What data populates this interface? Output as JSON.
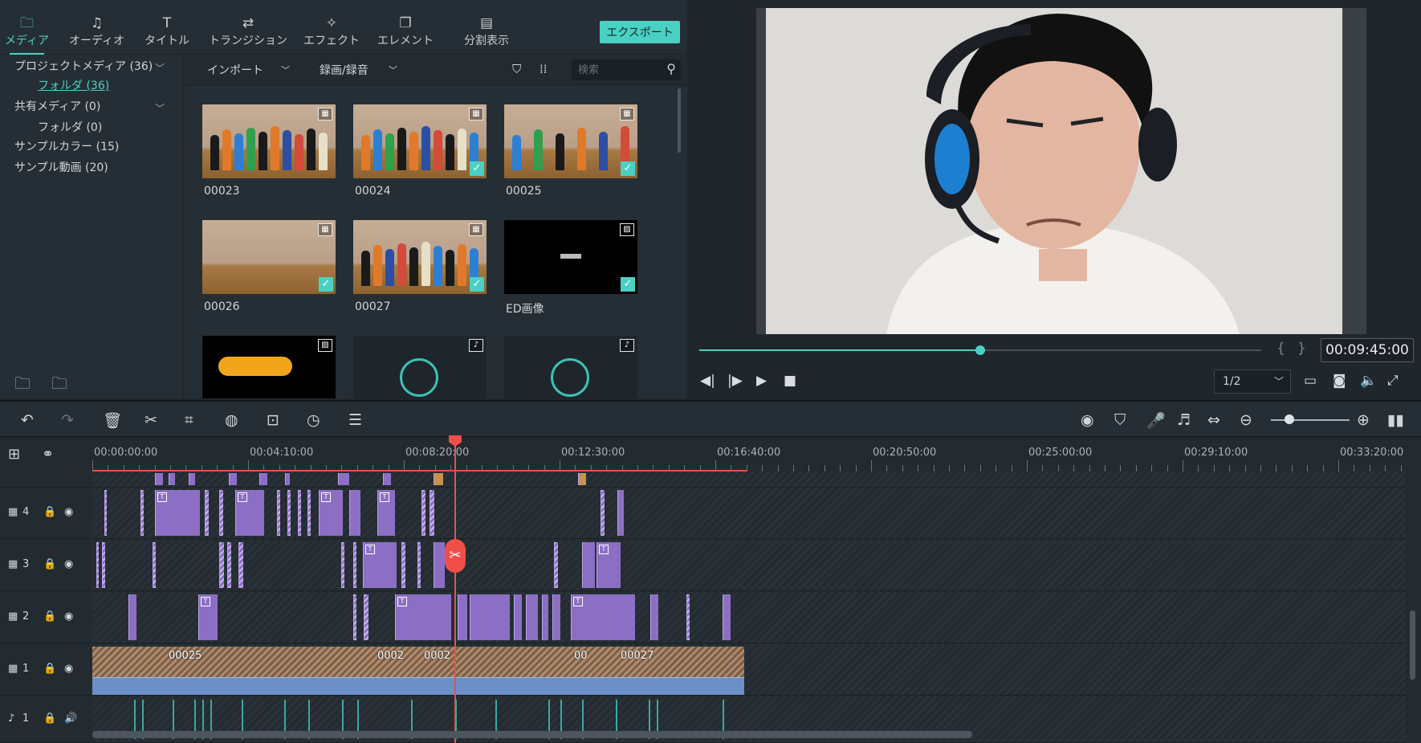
{
  "toolbar": {
    "tabs": [
      {
        "label": "メディア",
        "icon": "folder-icon",
        "glyph": "🗀"
      },
      {
        "label": "オーディオ",
        "icon": "music-note-icon",
        "glyph": "♫"
      },
      {
        "label": "タイトル",
        "icon": "title-icon",
        "glyph": "T"
      },
      {
        "label": "トランジション",
        "icon": "transition-icon",
        "glyph": "⇄"
      },
      {
        "label": "エフェクト",
        "icon": "effect-icon",
        "glyph": "✧"
      },
      {
        "label": "エレメント",
        "icon": "element-icon",
        "glyph": "❐"
      },
      {
        "label": "分割表示",
        "icon": "split-screen-icon",
        "glyph": "▤"
      }
    ],
    "export_label": "エクスポート",
    "accent": "#4ad1c4"
  },
  "library": {
    "project_media": "プロジェクトメディア (36)",
    "project_folder": "フォルダ (36)",
    "shared_media": "共有メディア (0)",
    "shared_folder": "フォルダ (0)",
    "sample_color": "サンプルカラー (15)",
    "sample_video": "サンプル動画 (20)"
  },
  "media_toolbar": {
    "import_label": "インポート",
    "record_label": "録画/録音",
    "search_placeholder": "検索"
  },
  "media_items": [
    {
      "name": "00023",
      "kind": "video",
      "checked": false
    },
    {
      "name": "00024",
      "kind": "video",
      "checked": true
    },
    {
      "name": "00025",
      "kind": "video",
      "checked": true
    },
    {
      "name": "00026",
      "kind": "video",
      "checked": true
    },
    {
      "name": "00027",
      "kind": "video",
      "checked": true
    },
    {
      "name": "ED画像",
      "kind": "image",
      "checked": true
    },
    {
      "name": "",
      "kind": "image",
      "checked": false
    },
    {
      "name": "",
      "kind": "audio",
      "checked": false
    },
    {
      "name": "",
      "kind": "audio",
      "checked": false
    }
  ],
  "preview": {
    "timecode": "00:09:45:00",
    "progress": 0.5,
    "quality": "1/2"
  },
  "ruler": {
    "labels": [
      "00:00:00:00",
      "00:04:10:00",
      "00:08:20:00",
      "00:12:30:00",
      "00:16:40:00",
      "00:20:50:00",
      "00:25:00:00",
      "00:29:10:00",
      "00:33:20:00"
    ]
  },
  "tracks": [
    {
      "label": "4",
      "type": "video"
    },
    {
      "label": "3",
      "type": "video"
    },
    {
      "label": "2",
      "type": "video"
    },
    {
      "label": "1",
      "type": "video"
    },
    {
      "label": "1",
      "type": "audio"
    }
  ],
  "main_clip_labels": [
    "00025",
    "0002",
    "0002",
    "00",
    "00027"
  ]
}
